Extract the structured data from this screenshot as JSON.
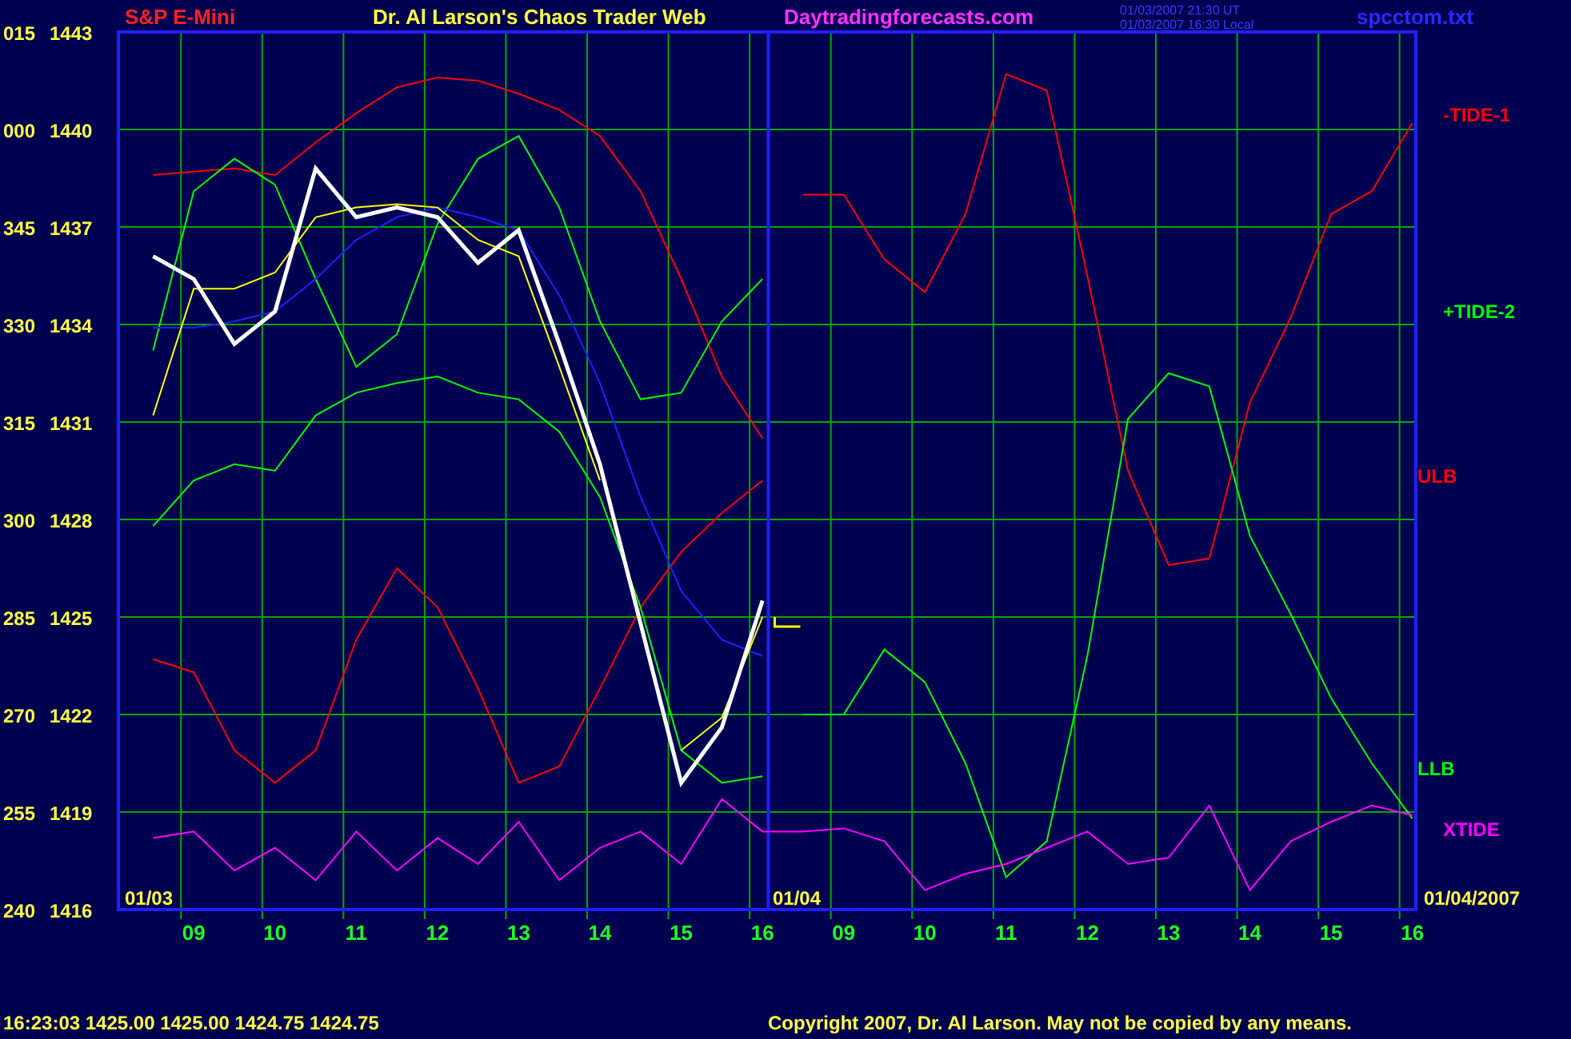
{
  "header": {
    "symbol": "S&P E-Mini",
    "title": "Dr. Al Larson's Chaos Trader Web",
    "site": "Daytradingforecasts.com",
    "timestamps": [
      "01/03/2007 21:30 UT",
      "01/03/2007 16:30 Local"
    ],
    "file": "spcctom.txt"
  },
  "chart": {
    "chart_data": {
      "type": "line",
      "categories": [
        null,
        "09",
        null,
        "10",
        null,
        "11",
        null,
        "12",
        null,
        "13",
        null,
        "14",
        null,
        "15",
        null,
        "16",
        null,
        "09",
        null,
        "10",
        null,
        "11",
        null,
        "12",
        null,
        "13",
        null,
        "14",
        null,
        "15",
        null,
        "16"
      ],
      "ylim": [
        1416,
        1443
      ],
      "grid": true,
      "yticks": [
        1443,
        1440,
        1437,
        1434,
        1431,
        1428,
        1425,
        1422,
        1419,
        1416
      ],
      "series": [
        {
          "color": "#ff0000",
          "values": [
            1438.6,
            1438.7,
            1438.8,
            1438.6,
            1439.6,
            1440.5,
            1441.3,
            1441.6,
            1441.5,
            1441.1,
            1440.6,
            1439.8,
            1438.1,
            1435.4,
            1432.4,
            1430.5,
            null,
            null,
            null,
            null,
            null,
            null,
            null,
            null,
            null,
            null,
            null,
            null,
            null,
            null,
            null,
            null
          ]
        },
        {
          "color": "#ff0000",
          "values": [
            null,
            null,
            null,
            null,
            null,
            null,
            null,
            null,
            null,
            null,
            null,
            null,
            null,
            null,
            null,
            null,
            1438.0,
            1438.0,
            1436.0,
            1435.0,
            1437.4,
            1441.7,
            1441.2,
            1435.5,
            1429.5,
            1426.6,
            1426.8,
            1431.6,
            1434.2,
            1437.4,
            1438.1,
            1440.2
          ]
        },
        {
          "color": "#ff0000",
          "values": [
            1423.7,
            1423.3,
            1420.9,
            1419.9,
            1420.9,
            1424.3,
            1426.5,
            1425.3,
            1422.8,
            1419.9,
            1420.4,
            1422.8,
            1425.3,
            1427.0,
            1428.2,
            1429.2,
            null,
            null,
            null,
            null,
            null,
            null,
            null,
            null,
            null,
            null,
            null,
            null,
            null,
            null,
            null,
            null
          ]
        },
        {
          "color": "#00ff00",
          "values": [
            1433.2,
            1438.1,
            1439.1,
            1438.3,
            1435.4,
            1432.7,
            1433.7,
            1437.1,
            1439.1,
            1439.8,
            1437.6,
            1434.1,
            1431.7,
            1431.9,
            1434.1,
            1435.4,
            null,
            null,
            null,
            null,
            null,
            null,
            null,
            null,
            null,
            null,
            null,
            null,
            null,
            null,
            null,
            null
          ]
        },
        {
          "color": "#00ff00",
          "values": [
            null,
            null,
            null,
            null,
            null,
            null,
            null,
            null,
            null,
            null,
            null,
            null,
            null,
            null,
            null,
            null,
            1422.0,
            1422.0,
            1424.0,
            1423.0,
            1420.5,
            1417.0,
            1418.1,
            1423.8,
            1431.1,
            1432.5,
            1432.1,
            1427.5,
            1425.1,
            1422.5,
            1420.5,
            1418.8
          ]
        },
        {
          "color": "#00ff00",
          "values": [
            1427.8,
            1429.2,
            1429.7,
            1429.5,
            1431.2,
            1431.9,
            1432.2,
            1432.4,
            1431.9,
            1431.7,
            1430.7,
            1428.7,
            1425.3,
            1420.9,
            1419.9,
            1420.1,
            null,
            null,
            null,
            null,
            null,
            null,
            null,
            null,
            null,
            null,
            null,
            null,
            null,
            null,
            null,
            null
          ]
        },
        {
          "color": "#2020ff",
          "values": [
            1433.9,
            1433.9,
            1434.1,
            1434.4,
            1435.4,
            1436.6,
            1437.3,
            1437.6,
            1437.3,
            1436.9,
            1434.9,
            1432.2,
            1428.7,
            1425.8,
            1424.3,
            1423.8,
            null,
            null,
            null,
            null,
            null,
            null,
            null,
            null,
            null,
            null,
            null,
            null,
            null,
            null,
            null,
            null
          ]
        },
        {
          "color": "#ffff00",
          "values": [
            1431.2,
            1435.1,
            1435.1,
            1435.6,
            1437.3,
            1437.6,
            1437.7,
            1437.6,
            1436.6,
            1436.1,
            1432.7,
            1429.2,
            null,
            1420.9,
            1421.9,
            1425.0,
            null,
            null,
            null,
            null,
            null,
            null,
            null,
            null,
            null,
            null,
            null,
            null,
            null,
            null,
            null,
            null
          ]
        },
        {
          "color": "#ff00ff",
          "values": [
            1418.2,
            1418.4,
            1417.2,
            1417.9,
            1416.9,
            1418.4,
            1417.2,
            1418.2,
            1417.4,
            1418.7,
            1416.9,
            1417.9,
            1418.4,
            1417.4,
            1419.4,
            1418.4,
            1418.4,
            1418.5,
            1418.1,
            1416.6,
            1417.1,
            1417.4,
            1417.9,
            1418.4,
            1417.4,
            1417.6,
            1419.2,
            1416.6,
            1418.1,
            1418.7,
            1419.2,
            1418.9
          ]
        },
        {
          "color": "#ffffff",
          "values": [
            1436.1,
            1435.4,
            1433.4,
            1434.4,
            1438.8,
            1437.3,
            1437.6,
            1437.3,
            1435.9,
            1436.9,
            1433.4,
            1429.7,
            1424.8,
            1419.9,
            1421.6,
            1425.5,
            null,
            null,
            null,
            null,
            null,
            null,
            null,
            null,
            null,
            null,
            null,
            null,
            null,
            null,
            null,
            null
          ]
        }
      ]
    },
    "left_scale": [
      "015",
      "000",
      "345",
      "330",
      "315",
      "300",
      "285",
      "270",
      "255",
      "240"
    ],
    "date_labels": [
      "01/03",
      "01/04",
      "01/04/2007"
    ],
    "line_labels": [
      {
        "text": "-TIDE-1",
        "color": "#ff0000"
      },
      {
        "text": "+TIDE-2",
        "color": "#00ff00"
      },
      {
        "text": "ULB",
        "color": "#ff0000"
      },
      {
        "text": "LLB",
        "color": "#00ff00"
      },
      {
        "text": "XTIDE",
        "color": "#ff00ff"
      }
    ]
  },
  "status_bar": {
    "quote": "16:23:03  1425.00 1425.00 1424.75 1424.75",
    "copyright": "Copyright 2007, Dr. Al Larson. May not be copied by any means."
  }
}
